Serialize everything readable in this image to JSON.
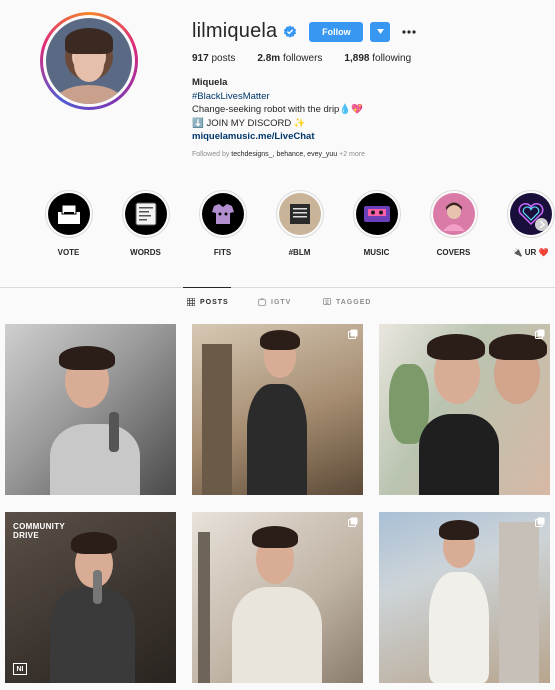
{
  "profile": {
    "username": "lilmiquela",
    "follow_label": "Follow",
    "stats": {
      "posts_count": "917",
      "posts_label": " posts",
      "followers_count": "2.8m",
      "followers_label": " followers",
      "following_count": "1,898",
      "following_label": " following"
    },
    "bio": {
      "name": "Miquela",
      "hashtag": "#BlackLivesMatter",
      "line": "Change-seeking robot with the drip💧💖",
      "discord": "⬇️ JOIN MY DISCORD ✨",
      "link": "miquelamusic.me/LiveChat"
    },
    "followed_by": {
      "prefix": "Followed by ",
      "accounts": "techdesigns_, behance, evey_yuu",
      "suffix": " +2 more"
    }
  },
  "highlights": [
    {
      "label": "VOTE",
      "icon": "ballot-box-icon"
    },
    {
      "label": "WORDS",
      "icon": "notepad-icon"
    },
    {
      "label": "FITS",
      "icon": "shirt-icon"
    },
    {
      "label": "#BLM",
      "icon": "blm-sign-icon"
    },
    {
      "label": "MUSIC",
      "icon": "cassette-icon"
    },
    {
      "label": "COVERS",
      "icon": "avatar-photo-icon"
    },
    {
      "label": "🔌 UR ❤️",
      "icon": "neon-heart-icon"
    }
  ],
  "tabs": [
    {
      "label": "POSTS",
      "icon": "grid-icon",
      "active": true
    },
    {
      "label": "IGTV",
      "icon": "igtv-icon",
      "active": false
    },
    {
      "label": "TAGGED",
      "icon": "tag-icon",
      "active": false
    }
  ],
  "posts": [
    {
      "kind": "single"
    },
    {
      "kind": "multiple"
    },
    {
      "kind": "multiple"
    },
    {
      "kind": "single",
      "overlay_text": "COMMUNITY\nDRIVE",
      "badge": "NI"
    },
    {
      "kind": "multiple"
    },
    {
      "kind": "multiple"
    }
  ],
  "colors": {
    "follow_blue": "#3897f0",
    "link_blue": "#00376b",
    "muted_gray": "#8e8e8e"
  }
}
